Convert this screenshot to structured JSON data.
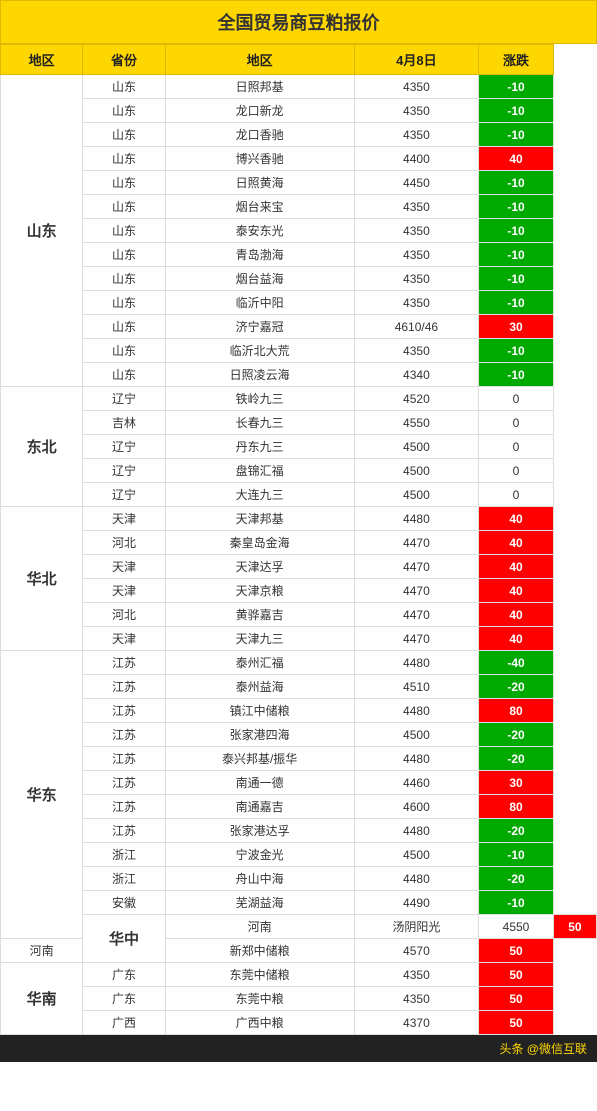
{
  "title": "全国贸易商豆粕报价",
  "headers": [
    "地区",
    "省份",
    "地区",
    "4月8日",
    "涨跌"
  ],
  "footer": "头条 @微信互联",
  "rows": [
    {
      "region": "山东",
      "province": "山东",
      "location": "日照邦基",
      "price": "4350",
      "change": "-10",
      "changeType": "green",
      "regionRowspan": 13,
      "showRegion": true
    },
    {
      "region": "",
      "province": "山东",
      "location": "龙口新龙",
      "price": "4350",
      "change": "-10",
      "changeType": "green",
      "showRegion": false
    },
    {
      "region": "",
      "province": "山东",
      "location": "龙口香驰",
      "price": "4350",
      "change": "-10",
      "changeType": "green",
      "showRegion": false
    },
    {
      "region": "",
      "province": "山东",
      "location": "博兴香驰",
      "price": "4400",
      "change": "40",
      "changeType": "red",
      "showRegion": false
    },
    {
      "region": "",
      "province": "山东",
      "location": "日照黄海",
      "price": "4450",
      "change": "-10",
      "changeType": "green",
      "showRegion": false
    },
    {
      "region": "",
      "province": "山东",
      "location": "烟台来宝",
      "price": "4350",
      "change": "-10",
      "changeType": "green",
      "showRegion": false
    },
    {
      "region": "",
      "province": "山东",
      "location": "泰安东光",
      "price": "4350",
      "change": "-10",
      "changeType": "green",
      "showRegion": false
    },
    {
      "region": "",
      "province": "山东",
      "location": "青岛渤海",
      "price": "4350",
      "change": "-10",
      "changeType": "green",
      "showRegion": false
    },
    {
      "region": "",
      "province": "山东",
      "location": "烟台益海",
      "price": "4350",
      "change": "-10",
      "changeType": "green",
      "showRegion": false
    },
    {
      "region": "",
      "province": "山东",
      "location": "临沂中阳",
      "price": "4350",
      "change": "-10",
      "changeType": "green",
      "showRegion": false
    },
    {
      "region": "",
      "province": "山东",
      "location": "济宁嘉冠",
      "price": "4610/46",
      "change": "30",
      "changeType": "red",
      "showRegion": false
    },
    {
      "region": "",
      "province": "山东",
      "location": "临沂北大荒",
      "price": "4350",
      "change": "-10",
      "changeType": "green",
      "showRegion": false
    },
    {
      "region": "",
      "province": "山东",
      "location": "日照凌云海",
      "price": "4340",
      "change": "-10",
      "changeType": "green",
      "showRegion": false
    },
    {
      "region": "东北",
      "province": "辽宁",
      "location": "铁岭九三",
      "price": "4520",
      "change": "0",
      "changeType": "neutral",
      "regionRowspan": 5,
      "showRegion": true
    },
    {
      "region": "",
      "province": "吉林",
      "location": "长春九三",
      "price": "4550",
      "change": "0",
      "changeType": "neutral",
      "showRegion": false
    },
    {
      "region": "",
      "province": "辽宁",
      "location": "丹东九三",
      "price": "4500",
      "change": "0",
      "changeType": "neutral",
      "showRegion": false
    },
    {
      "region": "",
      "province": "辽宁",
      "location": "盘锦汇福",
      "price": "4500",
      "change": "0",
      "changeType": "neutral",
      "showRegion": false
    },
    {
      "region": "",
      "province": "辽宁",
      "location": "大连九三",
      "price": "4500",
      "change": "0",
      "changeType": "neutral",
      "showRegion": false
    },
    {
      "region": "华北",
      "province": "天津",
      "location": "天津邦基",
      "price": "4480",
      "change": "40",
      "changeType": "red",
      "regionRowspan": 6,
      "showRegion": true
    },
    {
      "region": "",
      "province": "河北",
      "location": "秦皇岛金海",
      "price": "4470",
      "change": "40",
      "changeType": "red",
      "showRegion": false
    },
    {
      "region": "",
      "province": "天津",
      "location": "天津达孚",
      "price": "4470",
      "change": "40",
      "changeType": "red",
      "showRegion": false
    },
    {
      "region": "",
      "province": "天津",
      "location": "天津京粮",
      "price": "4470",
      "change": "40",
      "changeType": "red",
      "showRegion": false
    },
    {
      "region": "",
      "province": "河北",
      "location": "黄骅嘉吉",
      "price": "4470",
      "change": "40",
      "changeType": "red",
      "showRegion": false
    },
    {
      "region": "",
      "province": "天津",
      "location": "天津九三",
      "price": "4470",
      "change": "40",
      "changeType": "red",
      "showRegion": false
    },
    {
      "region": "华东",
      "province": "江苏",
      "location": "泰州汇福",
      "price": "4480",
      "change": "-40",
      "changeType": "green",
      "regionRowspan": 12,
      "showRegion": true
    },
    {
      "region": "",
      "province": "江苏",
      "location": "泰州益海",
      "price": "4510",
      "change": "-20",
      "changeType": "green",
      "showRegion": false
    },
    {
      "region": "",
      "province": "江苏",
      "location": "镇江中储粮",
      "price": "4480",
      "change": "80",
      "changeType": "red",
      "showRegion": false
    },
    {
      "region": "",
      "province": "江苏",
      "location": "张家港四海",
      "price": "4500",
      "change": "-20",
      "changeType": "green",
      "showRegion": false
    },
    {
      "region": "",
      "province": "江苏",
      "location": "泰兴邦基/振华",
      "price": "4480",
      "change": "-20",
      "changeType": "green",
      "showRegion": false
    },
    {
      "region": "",
      "province": "江苏",
      "location": "南通一德",
      "price": "4460",
      "change": "30",
      "changeType": "red",
      "showRegion": false
    },
    {
      "region": "",
      "province": "江苏",
      "location": "南通嘉吉",
      "price": "4600",
      "change": "80",
      "changeType": "red",
      "showRegion": false
    },
    {
      "region": "",
      "province": "江苏",
      "location": "张家港达孚",
      "price": "4480",
      "change": "-20",
      "changeType": "green",
      "showRegion": false
    },
    {
      "region": "",
      "province": "浙江",
      "location": "宁波金光",
      "price": "4500",
      "change": "-10",
      "changeType": "green",
      "showRegion": false
    },
    {
      "region": "",
      "province": "浙江",
      "location": "舟山中海",
      "price": "4480",
      "change": "-20",
      "changeType": "green",
      "showRegion": false
    },
    {
      "region": "",
      "province": "安徽",
      "location": "芜湖益海",
      "price": "4490",
      "change": "-10",
      "changeType": "green",
      "showRegion": false
    },
    {
      "region": "华中",
      "province": "河南",
      "location": "汤阴阳光",
      "price": "4550",
      "change": "50",
      "changeType": "red",
      "regionRowspan": 2,
      "showRegion": true
    },
    {
      "region": "",
      "province": "河南",
      "location": "新郑中储粮",
      "price": "4570",
      "change": "50",
      "changeType": "red",
      "showRegion": false
    },
    {
      "region": "华南",
      "province": "广东",
      "location": "东莞中储粮",
      "price": "4350",
      "change": "50",
      "changeType": "red",
      "regionRowspan": 3,
      "showRegion": true
    },
    {
      "region": "",
      "province": "广东",
      "location": "东莞中粮",
      "price": "4350",
      "change": "50",
      "changeType": "red",
      "showRegion": false
    },
    {
      "region": "",
      "province": "广西",
      "location": "广西中粮",
      "price": "4370",
      "change": "50",
      "changeType": "red",
      "showRegion": false
    }
  ]
}
